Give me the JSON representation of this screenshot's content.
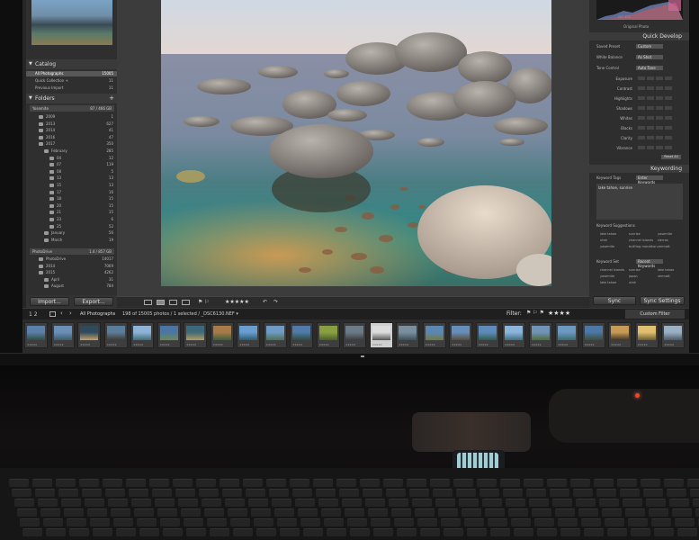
{
  "app": {
    "name": "Lightroom Library"
  },
  "catalog": {
    "title": "Catalog",
    "items": [
      {
        "label": "All Photographs",
        "count": "15005",
        "selected": true
      },
      {
        "label": "Quick Collection +",
        "count": "11"
      },
      {
        "label": "Previous Import",
        "count": "11"
      }
    ]
  },
  "folders": {
    "title": "Folders",
    "volumes": [
      {
        "name": "Yosemite",
        "count": "87 / 466 GB"
      },
      {
        "name": "PhotoDrive",
        "count": "1.4 / 857 GB"
      }
    ],
    "items": [
      {
        "label": "2009",
        "count": "1",
        "level": 1
      },
      {
        "label": "2013",
        "count": "627",
        "level": 1
      },
      {
        "label": "2014",
        "count": "41",
        "level": 1
      },
      {
        "label": "2016",
        "count": "47",
        "level": 1
      },
      {
        "label": "2017",
        "count": "350",
        "level": 1
      },
      {
        "label": "February",
        "count": "285",
        "level": 2
      },
      {
        "label": "04",
        "count": "12",
        "level": 3
      },
      {
        "label": "07",
        "count": "119",
        "level": 3
      },
      {
        "label": "08",
        "count": "5",
        "level": 3
      },
      {
        "label": "13",
        "count": "13",
        "level": 3
      },
      {
        "label": "15",
        "count": "13",
        "level": 3
      },
      {
        "label": "17",
        "count": "16",
        "level": 3
      },
      {
        "label": "18",
        "count": "15",
        "level": 3
      },
      {
        "label": "20",
        "count": "15",
        "level": 3
      },
      {
        "label": "21",
        "count": "15",
        "level": 3
      },
      {
        "label": "23",
        "count": "6",
        "level": 3
      },
      {
        "label": "25",
        "count": "52",
        "level": 3
      },
      {
        "label": "January",
        "count": "56",
        "level": 2
      },
      {
        "label": "March",
        "count": "19",
        "level": 2
      }
    ],
    "items2": [
      {
        "label": "PhotoDrive",
        "count": "14017",
        "level": 1
      },
      {
        "label": "2014",
        "count": "7069",
        "level": 1
      },
      {
        "label": "2015",
        "count": "4262",
        "level": 1
      },
      {
        "label": "April",
        "count": "31",
        "level": 2
      },
      {
        "label": "August",
        "count": "784",
        "level": 2
      }
    ]
  },
  "buttons": {
    "import": "Import...",
    "export": "Export...",
    "sync": "Sync",
    "sync_settings": "Sync Settings"
  },
  "toolbar": {
    "stars": "★★★★★"
  },
  "quick_develop": {
    "title": "Quick Develop",
    "saved_preset_label": "Saved Preset",
    "saved_preset_value": "Custom",
    "white_balance_label": "White Balance",
    "white_balance_value": "As Shot",
    "tone_control_label": "Tone Control",
    "tone_control_value": "Auto Tone",
    "sliders": [
      "Exposure",
      "Contrast",
      "Highlights",
      "Shadows",
      "Whites",
      "Blacks",
      "Clarity",
      "Vibrance"
    ],
    "reset": "Reset All"
  },
  "keywording": {
    "title": "Keywording",
    "tags_label": "Keyword Tags",
    "tags_value": "Enter Keywords",
    "keywords_text": "lake tahoe, sunrise",
    "suggestions_label": "Keyword Suggestions",
    "suggestions": [
      "lake tahoe",
      "sunrise",
      "yosemite",
      "utah",
      "channel islands",
      "sierras",
      "yosemite",
      "bullfrog marathon",
      "zermatt"
    ],
    "set_label": "Keyword Set",
    "set_value": "Recent Keywords",
    "recent": [
      "channel islands",
      "sunrise",
      "lake tahoe",
      "yosemite",
      "japan",
      "zermatt",
      "lake tahoe",
      "utah"
    ]
  },
  "histogram": {
    "info": "ISO 100",
    "info2": "Original Photo"
  },
  "filmstrip": {
    "source": "All Photographs",
    "status": "198 of 15005 photos / 1 selected / _DSC6130.NEF ▾",
    "filter_label": "Filter:",
    "filter_value": "Custom Filter",
    "stars": "★★★★"
  }
}
